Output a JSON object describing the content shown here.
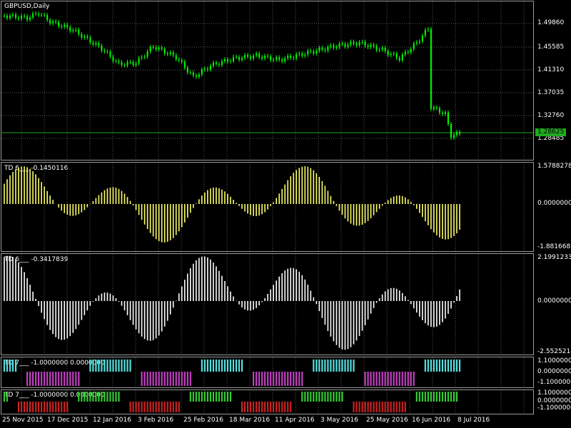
{
  "window": {
    "title": "GBPUSD,Daily"
  },
  "price_axis": [
    "1.49860",
    "1.45585",
    "1.41310",
    "1.37035",
    "1.32760",
    "1.28485"
  ],
  "current_price": "1.28625",
  "panes": [
    {
      "title": "TD 6___ -0.1450116",
      "top": "1.5788278",
      "zero": "0.0000000",
      "bottom": "-1.8816685"
    },
    {
      "title": "TD 6___ -0.3417839",
      "top": "2.1991233",
      "zero": "0.0000000",
      "bottom": "-2.5525214"
    },
    {
      "title": "TD 7___ -1.0000000 0.0000000",
      "top": "1.1000000",
      "zero": "0.0000000",
      "bottom": "-1.1000000"
    },
    {
      "title": "TD 7___ -1.0000000 0.0000000",
      "top": "1.1000000",
      "zero": "0.0000000",
      "bottom": "-1.1000000"
    }
  ],
  "dates": [
    "25 Nov 2015",
    "17 Dec 2015",
    "12 Jan 2016",
    "3 Feb 2016",
    "25 Feb 2016",
    "18 Mar 2016",
    "11 Apr 2016",
    "3 May 2016",
    "25 May 2016",
    "16 Jun 2016",
    "8 Jul 2016"
  ],
  "colors": {
    "candles": "#00ff00",
    "hist1": "#ffff66",
    "hist2": "#ffffff",
    "state_up": "#55e0e0",
    "state_down": "#c040c0",
    "state2_up": "#33cc33",
    "state2_down": "#cc2222",
    "grid": "#5a5a5a"
  }
}
